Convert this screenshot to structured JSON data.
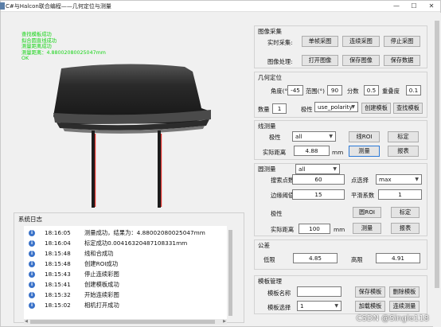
{
  "window": {
    "title": "C#与Halcon联合编程——几何定位与测量"
  },
  "overlay": {
    "lines": [
      "查找模板成功",
      "拟合圆直线成功",
      "测量距离成功",
      "测量距离：4.88002080025047mm",
      "OK"
    ]
  },
  "log": {
    "title": "系统日志",
    "entries": [
      {
        "time": "18:16:05",
        "message": "测量成功，结果为：4.88002080025047mm"
      },
      {
        "time": "18:16:04",
        "message": "标定成功0.00416320487108331mm"
      },
      {
        "time": "18:15:48",
        "message": "线和合成功"
      },
      {
        "time": "18:15:48",
        "message": "创建ROI成功"
      },
      {
        "time": "18:15:43",
        "message": "停止连续彩图"
      },
      {
        "time": "18:15:41",
        "message": "创建模板成功"
      },
      {
        "time": "18:15:32",
        "message": "开始连续彩图"
      },
      {
        "time": "18:15:02",
        "message": "相机打开成功"
      }
    ]
  },
  "acquire": {
    "title": "图像采集",
    "realtime_label": "实时采集:",
    "single_btn": "单帧采图",
    "continuous_btn": "连续采图",
    "stop_btn": "停止采图",
    "process_label": "图像处理:",
    "open_btn": "打开图像",
    "save_img_btn": "保存图像",
    "save_data_btn": "保存数据"
  },
  "geo": {
    "title": "几何定位",
    "angle_label": "角度(°)",
    "angle_value": "-45",
    "range_label": "范围(°)",
    "range_value": "90",
    "score_label": "分数",
    "score_value": "0.5",
    "overlap_label": "重叠度",
    "overlap_value": "0.1",
    "count_label": "数量",
    "count_value": "1",
    "polarity_label": "极性",
    "polarity_value": "use_polarity",
    "create_btn": "创建模板",
    "find_btn": "查找模板"
  },
  "line": {
    "title": "线测量",
    "polarity_label": "极性",
    "polarity_value": "all",
    "roi_btn": "线ROI",
    "calib_btn": "标定",
    "dist_label": "实际距离",
    "dist_value": "4.88",
    "unit": "mm",
    "measure_btn": "测量",
    "report_btn": "报表"
  },
  "circle": {
    "title": "圆测量",
    "points_label": "搜索点数",
    "points_value": "60",
    "select_label": "点选择",
    "select_value": "max",
    "edge_label": "边缘阈值",
    "edge_value": "15",
    "smooth_label": "平滑系数",
    "smooth_value": "1",
    "polarity_label": "极性",
    "polarity_value": "all",
    "roi_btn": "圆ROI",
    "calib_btn": "标定",
    "dist_label": "实际距离",
    "dist_value": "100",
    "unit": "mm",
    "measure_btn": "测量",
    "report_btn": "报表"
  },
  "tolerance": {
    "title": "公差",
    "low_label": "低限",
    "low_value": "4.85",
    "high_label": "高限",
    "high_value": "4.91"
  },
  "template": {
    "title": "模板管理",
    "name_label": "模板名称",
    "name_value": "",
    "save_btn": "保存模板",
    "delete_btn": "删除模板",
    "select_label": "模板选择",
    "select_value": "1",
    "load_btn": "加载模板",
    "continuous_btn": "连续测量"
  },
  "watermark": "CSDN @Single118",
  "colors": {
    "overlay_text": "#14d414",
    "measure_line": "#e0302a",
    "focus_border": "#2b79d6",
    "log_icon": "#3a72c9"
  }
}
